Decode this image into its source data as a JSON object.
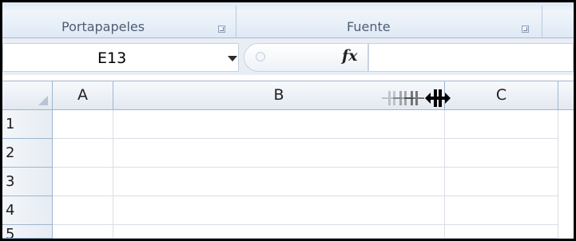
{
  "ribbon": {
    "groups": [
      {
        "label": "Portapapeles"
      },
      {
        "label": "Fuente"
      }
    ]
  },
  "formula_bar": {
    "name_box_value": "E13",
    "fx_label": "fx",
    "formula_value": ""
  },
  "grid": {
    "columns": [
      "A",
      "B",
      "C"
    ],
    "rows": [
      "1",
      "2",
      "3",
      "4",
      "5"
    ]
  },
  "icons": {
    "launcher": "dialog-launcher-icon",
    "dropdown": "chevron-down-icon",
    "cancel": "cancel-icon",
    "cursor": "column-resize-cursor-icon"
  }
}
